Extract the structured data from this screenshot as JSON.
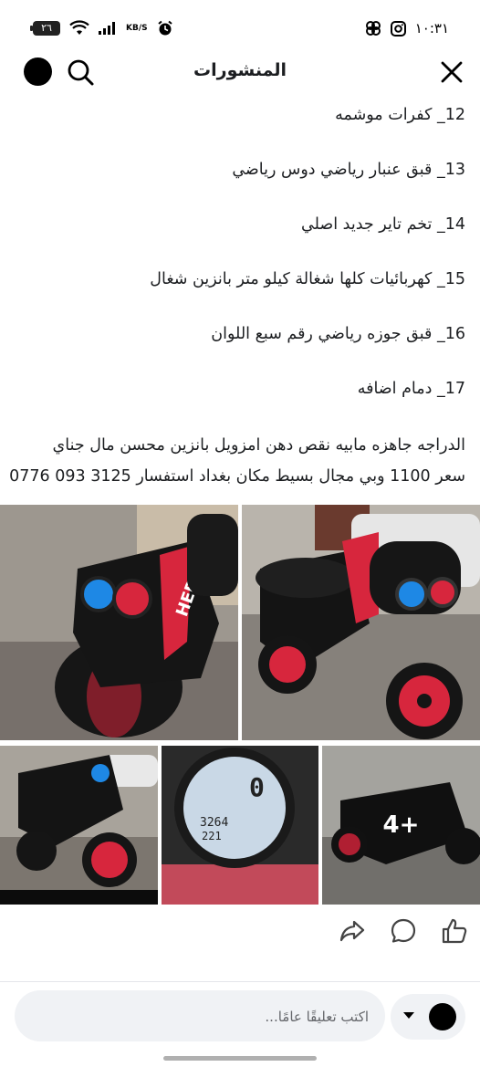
{
  "status": {
    "battery": "٢٦",
    "speed_unit": "KB/S",
    "time": "١٠:٣١"
  },
  "header": {
    "title": "المنشورات"
  },
  "post": {
    "lines": [
      "12_ كفرات موشمه",
      "13_ قبق عنبار رياضي دوس رياضي",
      "14_ تخم تاير جديد اصلي",
      "15_ كهربائيات كلها شغالة كيلو متر بانزين شغال",
      "16_ قبق جوزه رياضي رقم سبع اللوان",
      "17_ دمام اضافه",
      "الدراجه جاهزه مابيه نقص دهن امزويل بانزين محسن مال جناي",
      "سعر 1100 وبي مجال بسيط مكان بغداد استفسار 3125 093 0776"
    ],
    "photos_more": "4+",
    "speedo": {
      "speed": "0",
      "odo": "3264",
      "trip": "221"
    },
    "brand_text": "HERZ",
    "colors": {
      "bike_red": "#d7263d",
      "bike_black": "#151515",
      "light_blue": "#1e88e5"
    }
  },
  "actions": {
    "like": "like-icon",
    "comment": "comment-icon",
    "share": "share-icon"
  },
  "composer": {
    "placeholder": "اكتب تعليقًا عامًا..."
  }
}
